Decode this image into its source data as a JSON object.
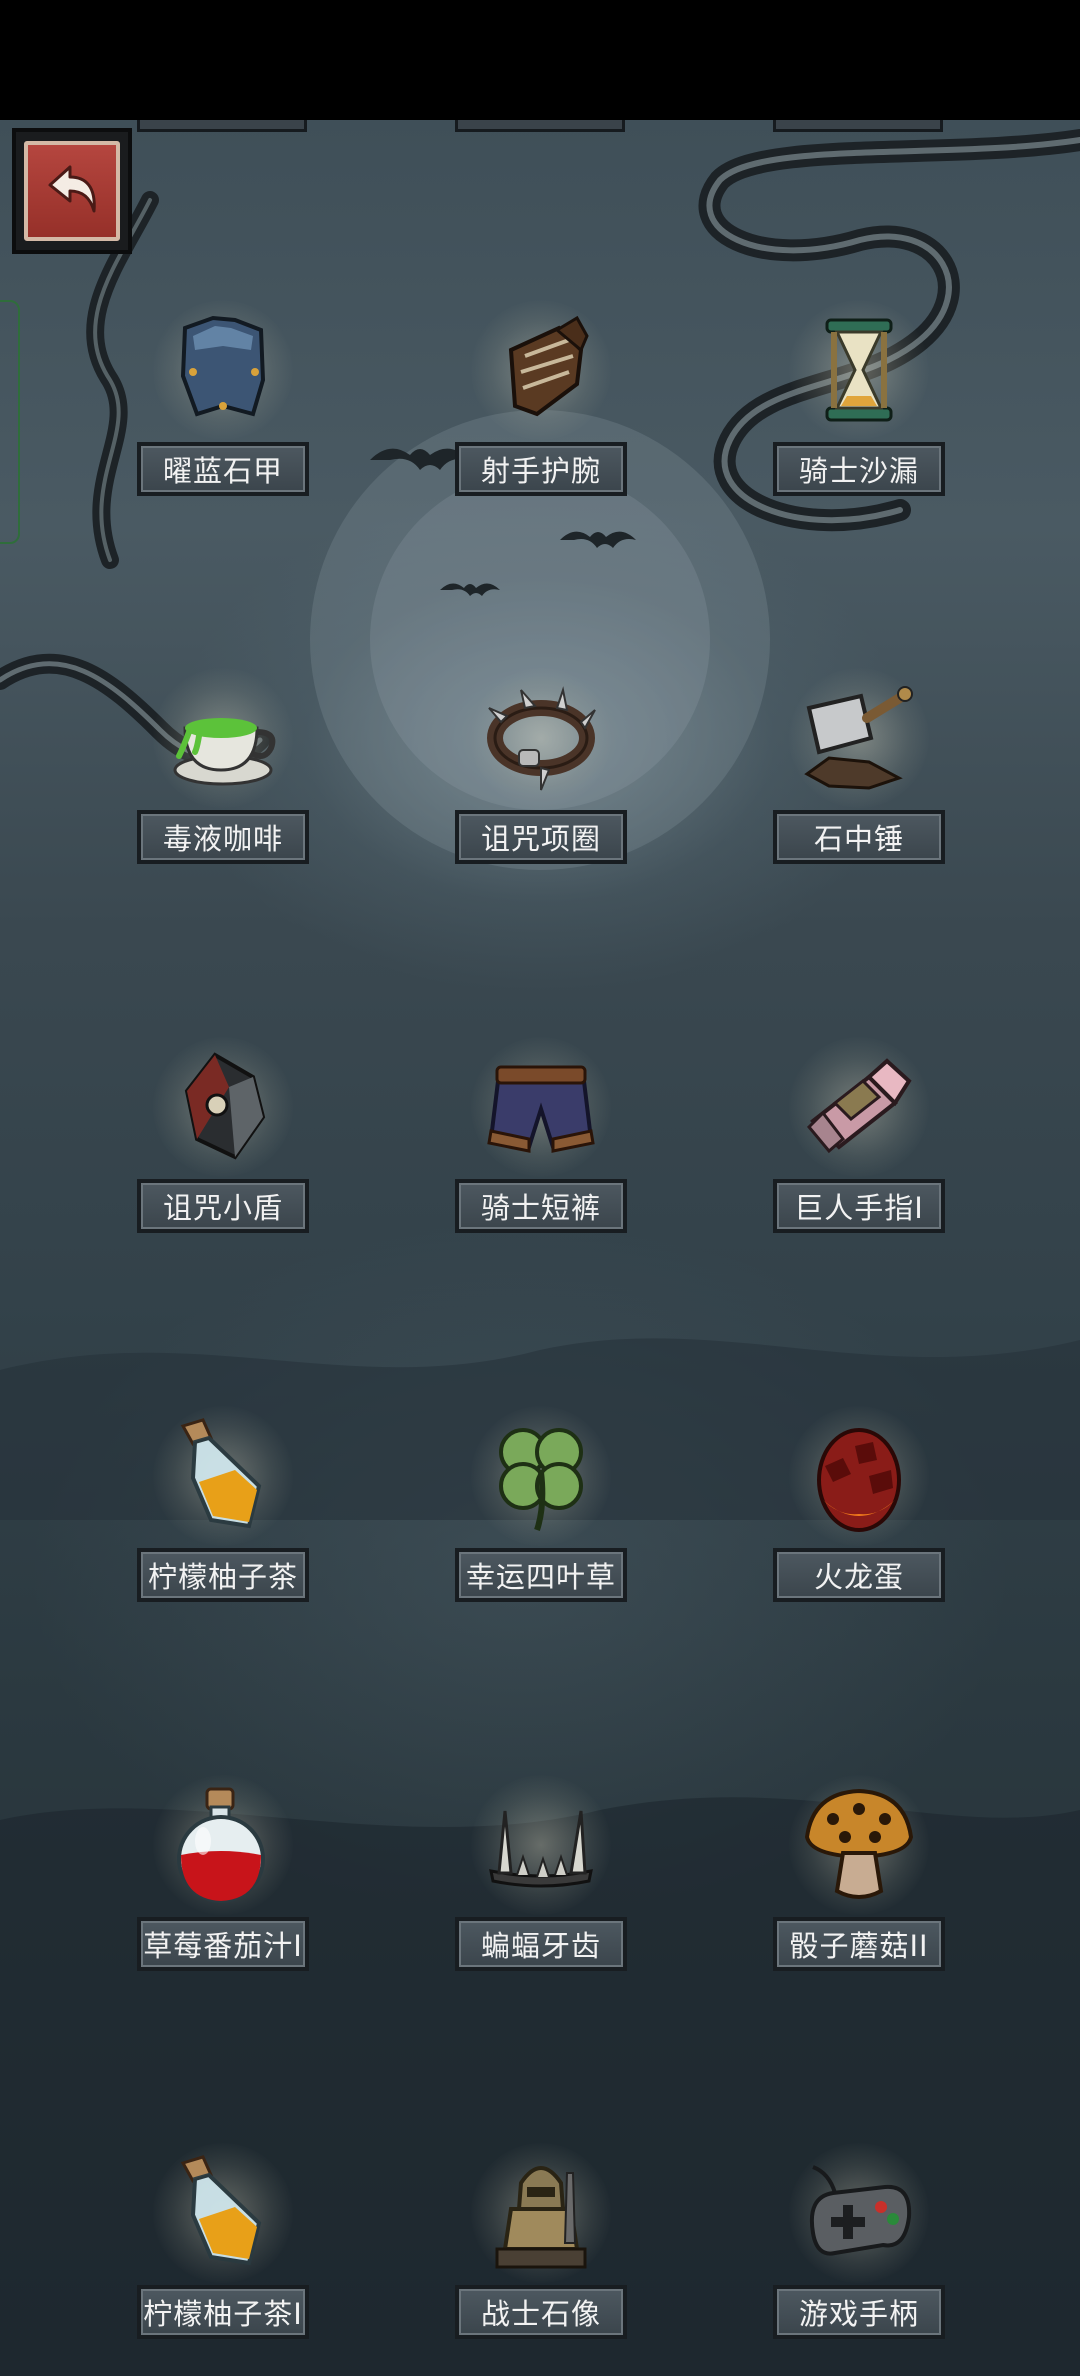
{
  "header": {
    "back_icon": "return-arrow-icon"
  },
  "colors": {
    "label_text": "#f2f2f2",
    "back_button_red": "#b5463f",
    "side_tab_green": "#2f6d3b"
  },
  "items": [
    {
      "name": "曜蓝石甲",
      "icon": "blue-armor-icon"
    },
    {
      "name": "射手护腕",
      "icon": "archer-bracer-icon"
    },
    {
      "name": "骑士沙漏",
      "icon": "knight-hourglass-icon"
    },
    {
      "name": "毒液咖啡",
      "icon": "venom-coffee-icon"
    },
    {
      "name": "诅咒项圈",
      "icon": "cursed-collar-icon"
    },
    {
      "name": "石中锤",
      "icon": "stone-hammer-icon"
    },
    {
      "name": "诅咒小盾",
      "icon": "cursed-shield-icon"
    },
    {
      "name": "骑士短裤",
      "icon": "knight-shorts-icon"
    },
    {
      "name": "巨人手指I",
      "icon": "giant-finger-icon"
    },
    {
      "name": "柠檬柚子茶",
      "icon": "citron-tea-bottle-icon"
    },
    {
      "name": "幸运四叶草",
      "icon": "four-leaf-clover-icon"
    },
    {
      "name": "火龙蛋",
      "icon": "dragon-egg-icon"
    },
    {
      "name": "草莓番茄汁I",
      "icon": "strawberry-juice-flask-icon"
    },
    {
      "name": "蝙蝠牙齿",
      "icon": "bat-teeth-icon"
    },
    {
      "name": "骰子蘑菇II",
      "icon": "dice-mushroom-icon"
    },
    {
      "name": "柠檬柚子茶I",
      "icon": "citron-tea-bottle-icon"
    },
    {
      "name": "战士石像",
      "icon": "warrior-statue-icon"
    },
    {
      "name": "游戏手柄",
      "icon": "gamepad-icon"
    }
  ]
}
